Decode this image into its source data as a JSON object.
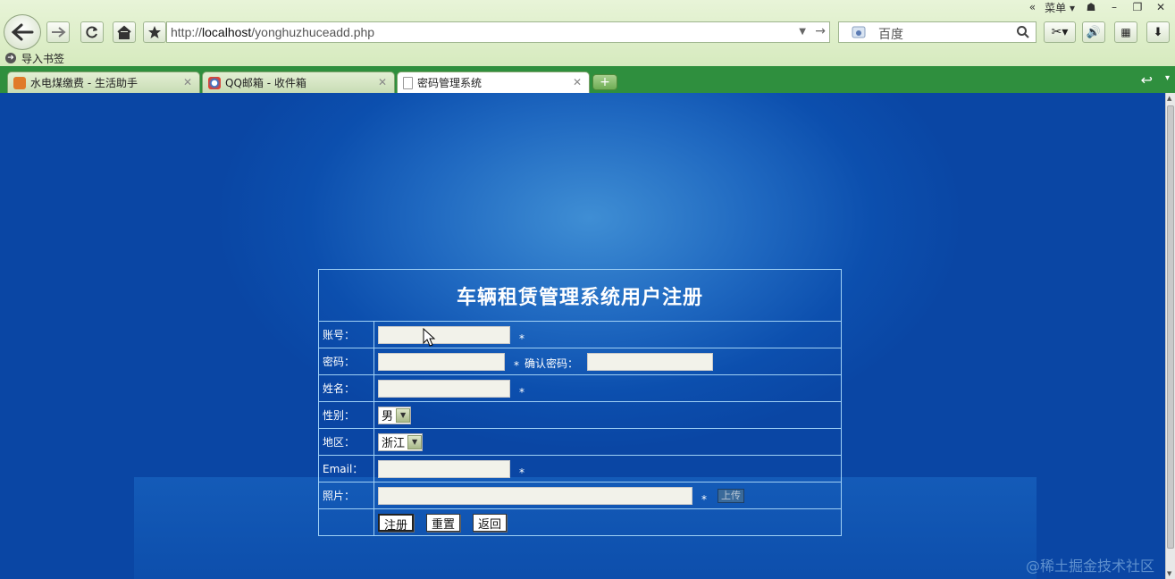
{
  "titlebar": {
    "menu_label": "菜单"
  },
  "toolbar": {
    "url_prefix": "http://",
    "url_host": "localhost",
    "url_path": "/yonghuzhuceadd.php",
    "search_placeholder": "百度"
  },
  "bookmarks": {
    "import_label": "导入书签"
  },
  "tabs": [
    {
      "label": "水电煤缴费 - 生活助手"
    },
    {
      "label": "QQ邮箱 - 收件箱"
    },
    {
      "label": "密码管理系统"
    }
  ],
  "form": {
    "title": "车辆租赁管理系统用户注册",
    "account_label": "账号：",
    "password_label": "密码：",
    "confirm_password_label": "确认密码：",
    "name_label": "姓名：",
    "gender_label": "性别：",
    "gender_value": "男",
    "region_label": "地区：",
    "region_value": "浙江",
    "email_label": "Email：",
    "photo_label": "照片：",
    "required_mark": "*",
    "upload_label": "上传",
    "register_label": "注册",
    "reset_label": "重置",
    "back_label": "返回"
  },
  "watermark": "@稀土掘金技术社区"
}
